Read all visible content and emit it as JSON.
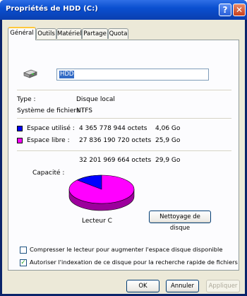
{
  "window": {
    "title": "Propriétés de HDD (C:)"
  },
  "tabs": [
    "Général",
    "Outils",
    "Matériel",
    "Partage",
    "Quota"
  ],
  "general": {
    "drive_name": "HDD",
    "type_label": "Type :",
    "type_value": "Disque local",
    "fs_label": "Système de fichiers :",
    "fs_value": "NTFS",
    "used_label": "Espace utilisé :",
    "used_bytes": "4 365 778 944 octets",
    "used_size": "4,06 Go",
    "free_label": "Espace libre :",
    "free_bytes": "27 836 190 720 octets",
    "free_size": "25,9 Go",
    "capacity_label": "Capacité :",
    "capacity_bytes": "32 201 969 664 octets",
    "capacity_size": "29,9 Go",
    "drive_label": "Lecteur C",
    "cleanup_button": "Nettoyage de disque",
    "compress_label": "Compresser le lecteur pour augmenter l'espace disque disponible",
    "compress_checked": false,
    "index_label": "Autoriser l'indexation de ce disque pour la recherche rapide de fichiers",
    "index_checked": true
  },
  "pie": {
    "used_fraction": 0.1356,
    "used_color": "#0000ff",
    "free_color": "#ff00ff"
  },
  "buttons": {
    "ok": "OK",
    "cancel": "Annuler",
    "apply": "Appliquer"
  },
  "icons": {
    "drive": "hard-drive-icon",
    "help": "help-icon",
    "close": "close-icon"
  }
}
